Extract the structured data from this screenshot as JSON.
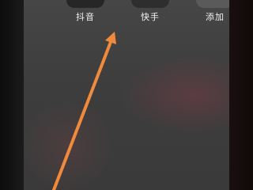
{
  "apps": [
    {
      "label": "抖音",
      "icon": "douyin-app-icon",
      "icon_color": "#262626"
    },
    {
      "label": "快手",
      "icon": "kuaishou-app-icon",
      "icon_color": "#2e2e2e"
    },
    {
      "label": "添加",
      "icon": "add-app-icon",
      "icon_color": "#5a5a5a"
    }
  ],
  "colors": {
    "background": "#3d3d3d",
    "arrow": "#f08a3c"
  }
}
